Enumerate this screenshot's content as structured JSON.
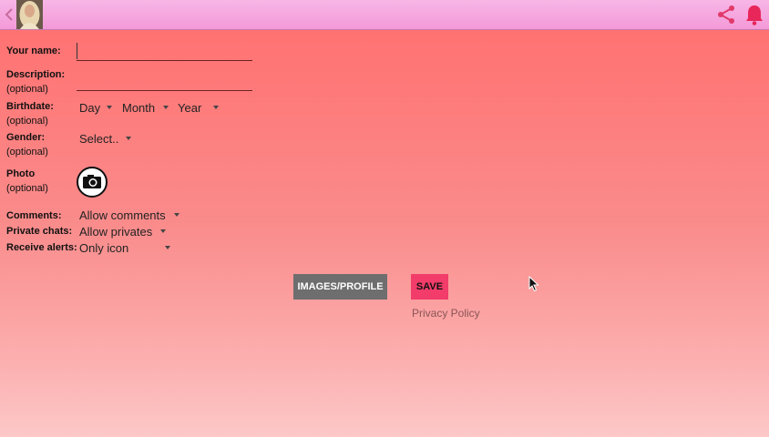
{
  "form": {
    "name_label": "Your name:",
    "description_label": "Description:",
    "optional": "(optional)",
    "birthdate_label": "Birthdate:",
    "birth_day": "Day",
    "birth_month": "Month",
    "birth_year": "Year",
    "gender_label": "Gender:",
    "gender_value": "Select..",
    "photo_label": "Photo",
    "comments_label": "Comments:",
    "comments_value": "Allow comments",
    "private_label": "Private chats:",
    "private_value": "Allow privates",
    "alerts_label": "Receive alerts:",
    "alerts_value": "Only icon"
  },
  "actions": {
    "images_profile": "IMAGES/PROFILE",
    "save": "SAVE",
    "privacy": "Privacy Policy"
  },
  "colors": {
    "topbar": "#f49ad8",
    "accent_pink": "#f23c6a",
    "grey_button": "#6e6e6e"
  }
}
